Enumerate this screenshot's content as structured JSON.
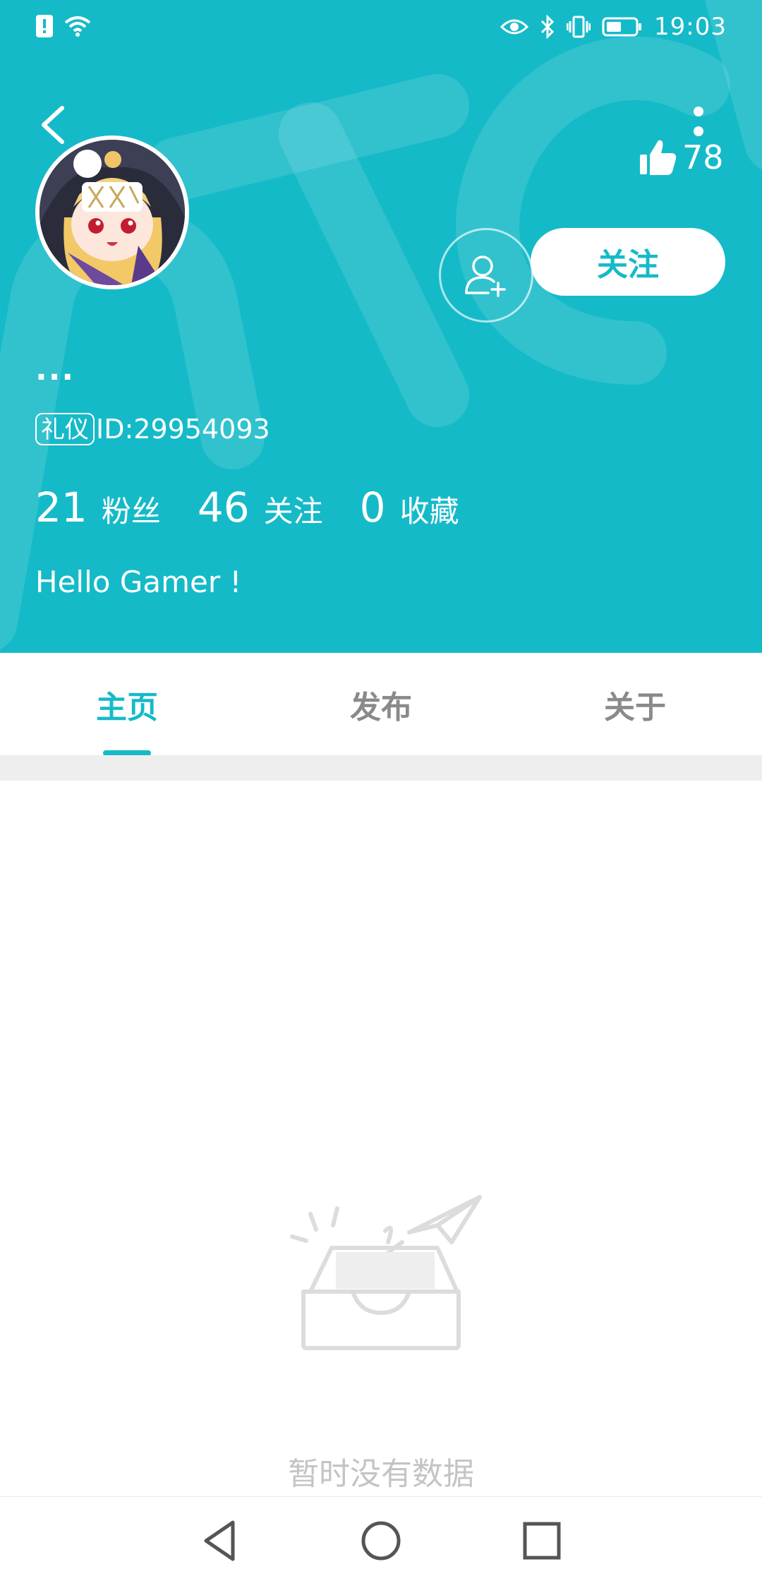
{
  "status_bar": {
    "time": "19:03",
    "icons": [
      "alert-icon",
      "wifi-icon",
      "eye-icon",
      "bluetooth-icon",
      "vibrate-icon",
      "battery-icon"
    ]
  },
  "profile": {
    "nickname": "...",
    "badge": "礼仪",
    "id_text": "ID:29954093",
    "likes": "78",
    "follow_label": "关注",
    "bio": "Hello Gamer !",
    "stats": [
      {
        "value": "21",
        "label": "粉丝"
      },
      {
        "value": "46",
        "label": "关注"
      },
      {
        "value": "0",
        "label": "收藏"
      }
    ]
  },
  "tabs": [
    {
      "label": "主页",
      "active": true
    },
    {
      "label": "发布",
      "active": false
    },
    {
      "label": "关于",
      "active": false
    }
  ],
  "empty_state": {
    "message": "暂时没有数据"
  },
  "colors": {
    "accent": "#15bac8",
    "empty_text": "#c4c4c4",
    "inactive_tab": "#8a8a8a"
  }
}
